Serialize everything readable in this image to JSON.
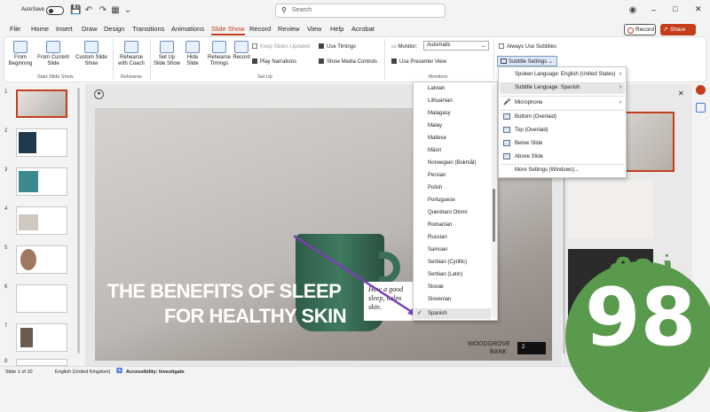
{
  "titlebar": {
    "autosave_label": "AutoSave",
    "search_placeholder": "Search"
  },
  "menu": {
    "tabs": [
      "File",
      "Home",
      "Insert",
      "Draw",
      "Design",
      "Transitions",
      "Animations",
      "Slide Show",
      "Record",
      "Review",
      "View",
      "Help",
      "Acrobat"
    ],
    "active_tab": "Slide Show",
    "record_button": "Record",
    "share_button": "Share"
  },
  "ribbon": {
    "from_beginning": "From Beginning",
    "from_current": "From Current Slide",
    "custom_show": "Custom Slide Show",
    "group_start": "Start Slide Show",
    "rehearse_coach": "Rehearse with Coach",
    "group_rehearse": "Rehearse",
    "setup_show": "Set Up Slide Show",
    "hide_slide": "Hide Slide",
    "rehearse_timings": "Rehearse Timings",
    "record": "Record",
    "keep_updated": "Keep Slides Updated",
    "play_narrations": "Play Narrations",
    "use_timings": "Use Timings",
    "show_media": "Show Media Controls",
    "group_setup": "Set Up",
    "monitor_label": "Monitor:",
    "monitor_value": "Automatic",
    "presenter_view": "Use Presenter View",
    "group_monitors": "Monitors",
    "always_subtitles": "Always Use Subtitles",
    "subtitle_settings": "Subtitle Settings"
  },
  "thumbnails": [
    "1",
    "2",
    "3",
    "4",
    "5",
    "6",
    "7",
    "8"
  ],
  "slide": {
    "title_line1": "THE BENEFITS OF SLEEP",
    "title_line2": "FOR HEALTHY SKIN",
    "quote": "How a good sleep, helps skin.",
    "brand_line1": "WOODGROVE",
    "brand_line2": "BANK",
    "page_number": "2"
  },
  "language_list": [
    "Latvian",
    "Lithuanian",
    "Malagasy",
    "Malay",
    "Maltese",
    "Māori",
    "Norwegian (Bokmål)",
    "Persian",
    "Polish",
    "Portuguese",
    "Querétaro Otomi",
    "Romanian",
    "Russian",
    "Samoan",
    "Serbian (Cyrillic)",
    "Serbian (Latin)",
    "Slovak",
    "Slovenian",
    "Spanish"
  ],
  "selected_language": "Spanish",
  "subtitle_menu": {
    "spoken": "Spoken Language: English (United States)",
    "subtitle_lang": "Subtitle Language: Spanish",
    "microphone": "Microphone",
    "bottom": "Bottom (Overlaid)",
    "top": "Top (Overlaid)",
    "below": "Below Slide",
    "above": "Above Slide",
    "more": "More Settings (Windows)..."
  },
  "status": {
    "slide_info": "Slide 1 of 10",
    "language": "English (United Kingdom)",
    "accessibility": "Accessibility: Investigate"
  },
  "watermark": {
    "text_top": "زوم",
    "number": "98"
  },
  "colors": {
    "accent": "#c43e1c",
    "watermark_green": "#5a9a4c"
  }
}
